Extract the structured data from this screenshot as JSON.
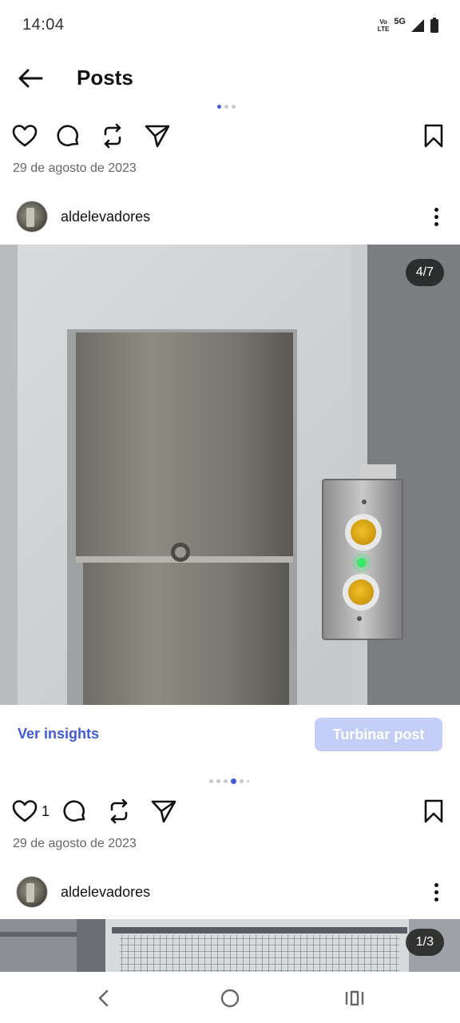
{
  "status_bar": {
    "time": "14:04",
    "volte_top": "Vo",
    "volte_bottom": "LTE",
    "network": "5G"
  },
  "header": {
    "title": "Posts"
  },
  "posts": [
    {
      "date": "29 de agosto de 2023",
      "likes": ""
    },
    {
      "username": "aldelevadores",
      "counter": "4/7",
      "insights_label": "Ver insights",
      "boost_label": "Turbinar post",
      "likes": "1",
      "date": "29 de agosto de 2023"
    },
    {
      "username": "aldelevadores",
      "counter": "1/3"
    }
  ],
  "icons": [
    "back-arrow-icon",
    "heart-icon",
    "comment-icon",
    "repost-icon",
    "share-icon",
    "bookmark-icon",
    "more-icon",
    "nav-back-icon",
    "nav-home-icon",
    "nav-recents-icon"
  ],
  "colors": {
    "accent": "#3f5bd6",
    "boost_button": "#c4cdf6",
    "badge_bg": "#1e1e1e"
  }
}
